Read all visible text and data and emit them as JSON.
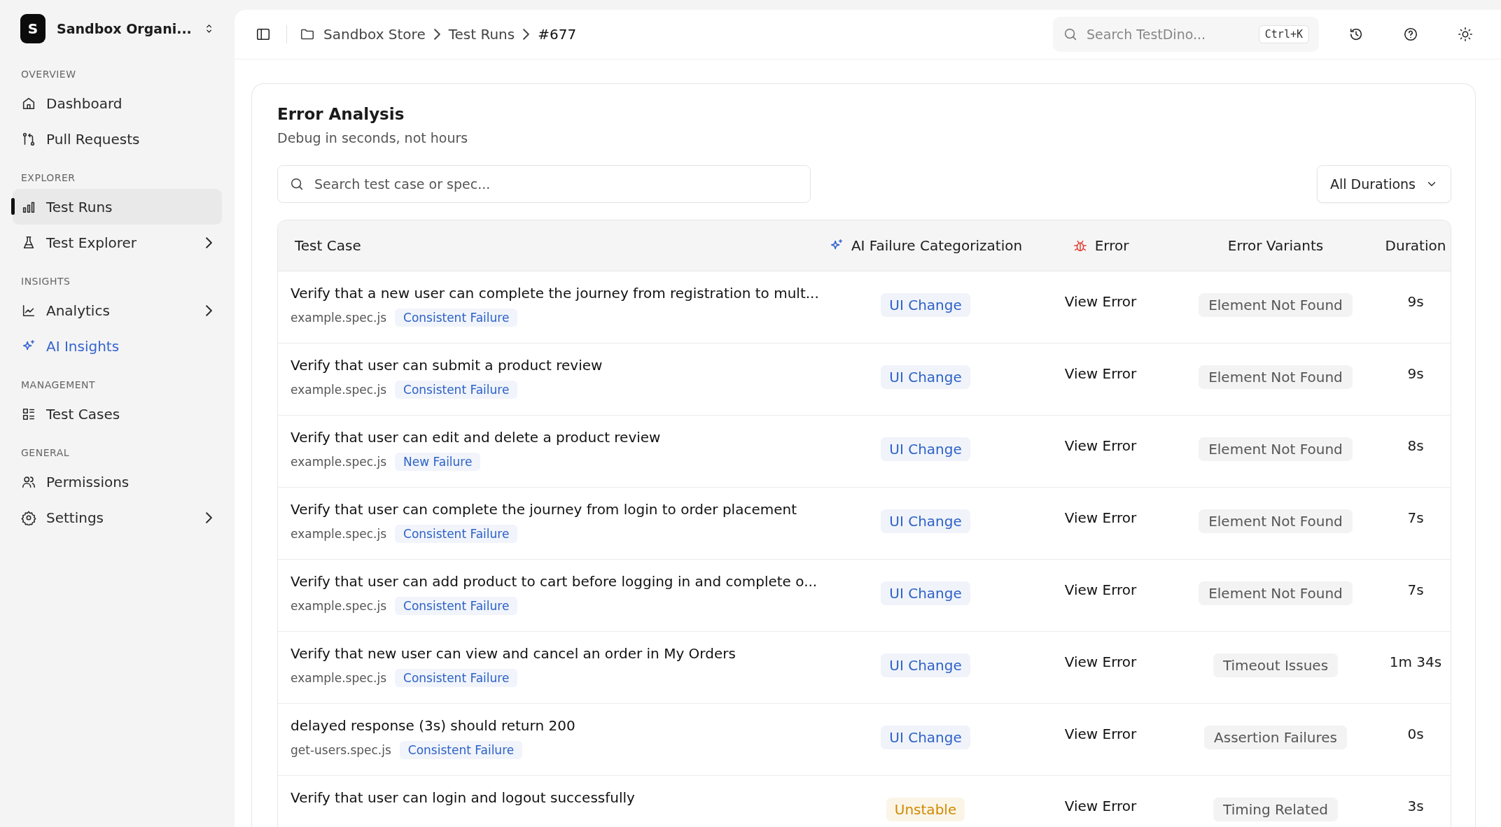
{
  "org": {
    "initial": "S",
    "name": "Sandbox Organi..."
  },
  "sidebar": {
    "sections": [
      {
        "label": "OVERVIEW",
        "items": [
          {
            "label": "Dashboard",
            "selected": false,
            "accent": false,
            "expandable": false
          },
          {
            "label": "Pull Requests",
            "selected": false,
            "accent": false,
            "expandable": false
          }
        ]
      },
      {
        "label": "EXPLORER",
        "items": [
          {
            "label": "Test Runs",
            "selected": true,
            "accent": false,
            "expandable": false
          },
          {
            "label": "Test Explorer",
            "selected": false,
            "accent": false,
            "expandable": true
          }
        ]
      },
      {
        "label": "INSIGHTS",
        "items": [
          {
            "label": "Analytics",
            "selected": false,
            "accent": false,
            "expandable": true
          },
          {
            "label": "AI Insights",
            "selected": false,
            "accent": true,
            "expandable": false
          }
        ]
      },
      {
        "label": "MANAGEMENT",
        "items": [
          {
            "label": "Test Cases",
            "selected": false,
            "accent": false,
            "expandable": false
          }
        ]
      },
      {
        "label": "GENERAL",
        "items": [
          {
            "label": "Permissions",
            "selected": false,
            "accent": false,
            "expandable": false
          },
          {
            "label": "Settings",
            "selected": false,
            "accent": false,
            "expandable": true
          }
        ]
      }
    ]
  },
  "breadcrumb": [
    "Sandbox Store",
    "Test Runs",
    "#677"
  ],
  "search": {
    "placeholder": "Search TestDino...",
    "shortcut": "Ctrl+K"
  },
  "card": {
    "title": "Error Analysis",
    "subtitle": "Debug in seconds, not hours",
    "search_placeholder": "Search test case or spec...",
    "duration_filter": "All Durations"
  },
  "table": {
    "columns": [
      "Test Case",
      "AI Failure Categorization",
      "Error",
      "Error Variants",
      "Duration"
    ],
    "rows": [
      {
        "title": "Verify that a new user can complete the journey from registration to mult...",
        "spec": "example.spec.js",
        "tag": "Consistent Failure",
        "category": "UI Change",
        "kind": "change",
        "error": "View Error",
        "variant": "Element Not Found",
        "duration": "9s"
      },
      {
        "title": "Verify that user can submit a product review",
        "spec": "example.spec.js",
        "tag": "Consistent Failure",
        "category": "UI Change",
        "kind": "change",
        "error": "View Error",
        "variant": "Element Not Found",
        "duration": "9s"
      },
      {
        "title": "Verify that user can edit and delete a product review",
        "spec": "example.spec.js",
        "tag": "New Failure",
        "category": "UI Change",
        "kind": "change",
        "error": "View Error",
        "variant": "Element Not Found",
        "duration": "8s"
      },
      {
        "title": "Verify that user can complete the journey from login to order placement",
        "spec": "example.spec.js",
        "tag": "Consistent Failure",
        "category": "UI Change",
        "kind": "change",
        "error": "View Error",
        "variant": "Element Not Found",
        "duration": "7s"
      },
      {
        "title": "Verify that user can add product to cart before logging in and complete o...",
        "spec": "example.spec.js",
        "tag": "Consistent Failure",
        "category": "UI Change",
        "kind": "change",
        "error": "View Error",
        "variant": "Element Not Found",
        "duration": "7s"
      },
      {
        "title": "Verify that new user can view and cancel an order in My Orders",
        "spec": "example.spec.js",
        "tag": "Consistent Failure",
        "category": "UI Change",
        "kind": "change",
        "error": "View Error",
        "variant": "Timeout Issues",
        "duration": "1m 34s"
      },
      {
        "title": "delayed response (3s) should return 200",
        "spec": "get-users.spec.js",
        "tag": "Consistent Failure",
        "category": "UI Change",
        "kind": "change",
        "error": "View Error",
        "variant": "Assertion Failures",
        "duration": "0s"
      },
      {
        "title": "Verify that user can login and logout successfully",
        "category": "Unstable",
        "kind": "unstable",
        "error": "View Error",
        "variant": "Timing Related",
        "duration": "3s"
      }
    ]
  }
}
